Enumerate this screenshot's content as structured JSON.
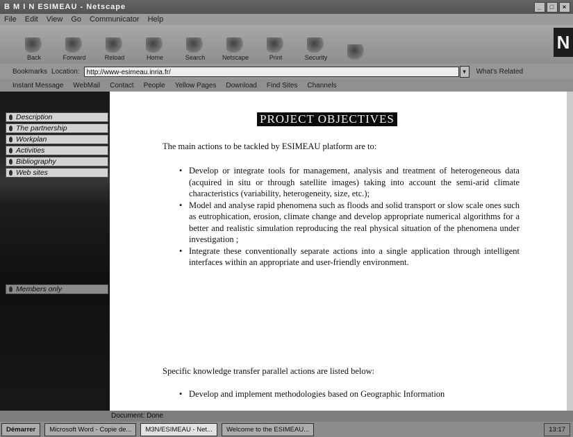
{
  "window": {
    "title": "B M I N ESIMEAU - Netscape"
  },
  "menu": [
    "File",
    "Edit",
    "View",
    "Go",
    "Communicator",
    "Help"
  ],
  "toolbar": [
    {
      "label": "Back",
      "icon": "back-icon"
    },
    {
      "label": "Forward",
      "icon": "forward-icon"
    },
    {
      "label": "Reload",
      "icon": "reload-icon"
    },
    {
      "label": "Home",
      "icon": "home-icon"
    },
    {
      "label": "Search",
      "icon": "search-icon"
    },
    {
      "label": "Netscape",
      "icon": "netscape-icon"
    },
    {
      "label": "Print",
      "icon": "print-icon"
    },
    {
      "label": "Security",
      "icon": "security-icon"
    },
    {
      "label": "",
      "icon": "stop-icon"
    }
  ],
  "location": {
    "bookmarks": "Bookmarks",
    "label": "Location:",
    "url": "http://www-esimeau.inria.fr/",
    "related": "What's Related"
  },
  "links": [
    "Instant Message",
    "WebMail",
    "Contact",
    "People",
    "Yellow Pages",
    "Download",
    "Find Sites",
    "Channels"
  ],
  "nav": {
    "items": [
      "Description",
      "The partnership",
      "Workplan",
      "Activities",
      "Bibliography",
      "Web sites"
    ],
    "members": "Members only"
  },
  "content": {
    "heading": "PROJECT OBJECTIVES",
    "intro": "The main actions to be tackled by ESIMEAU platform are to:",
    "objectives": [
      "Develop or integrate tools for management, analysis and treatment of heterogeneous data (acquired in situ or through satellite images) taking into account the semi-arid climate characteristics (variability, heterogeneity, size, etc.);",
      "Model and analyse rapid phenomena such as floods and solid transport or slow scale ones such as eutrophication, erosion, climate change and develop appropriate numerical algorithms for a better and realistic simulation reproducing the real physical situation of the phenomena under investigation ;",
      "Integrate these conventionally separate actions into a single application through intelligent interfaces within an appropriate and user-friendly environment."
    ],
    "specific": "Specific knowledge transfer parallel actions are listed below:",
    "transfer": [
      "Develop and implement methodologies based on Geographic Information"
    ]
  },
  "status": "Document: Done",
  "taskbar": {
    "start": "Démarrer",
    "tasks": [
      "Microsoft Word - Copie de...",
      "M3N/ESIMEAU - Net...",
      "Welcome to the ESIMEAU..."
    ],
    "clock": "13:17"
  }
}
